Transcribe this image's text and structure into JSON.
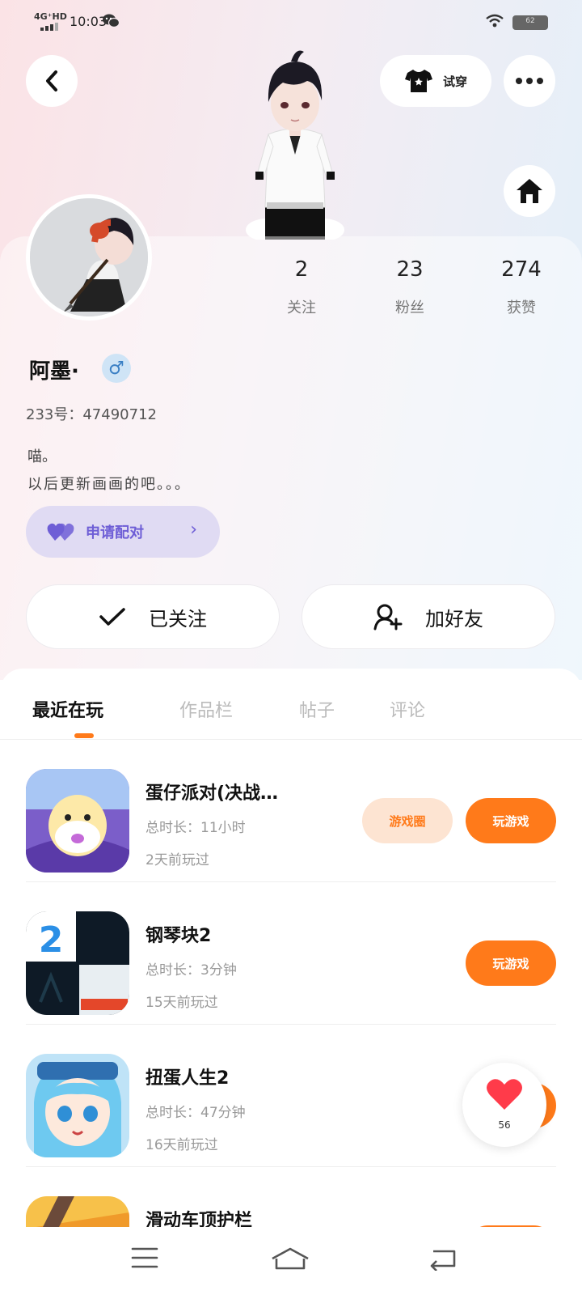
{
  "status_bar": {
    "network": "4G⁺HD",
    "time": "10:03",
    "battery": "62"
  },
  "header": {
    "try_on_label": "试穿"
  },
  "profile": {
    "stats": [
      {
        "count": "2",
        "label": "关注"
      },
      {
        "count": "23",
        "label": "粉丝"
      },
      {
        "count": "274",
        "label": "获赞"
      }
    ],
    "username": "阿墨·",
    "gender_symbol": "♂",
    "account_id": "233号：47490712",
    "bio_line1": "喵。",
    "bio_line2": "以后更新画画的吧。。。",
    "match_label": "申请配对",
    "followed_label": "已关注",
    "add_friend_label": "加好友"
  },
  "tabs": [
    {
      "label": "最近在玩",
      "active": true
    },
    {
      "label": "作品栏",
      "active": false
    },
    {
      "label": "帖子",
      "active": false
    },
    {
      "label": "评论",
      "active": false
    }
  ],
  "games": [
    {
      "name": "蛋仔派对(决战…",
      "total_time": "总时长：11小时",
      "last_played": "2天前玩过",
      "circle_label": "游戏圈",
      "play_label": "玩游戏"
    },
    {
      "name": "钢琴块2",
      "total_time": "总时长：3分钟",
      "last_played": "15天前玩过",
      "play_label": "玩游戏"
    },
    {
      "name": "扭蛋人生2",
      "total_time": "总时长：47分钟",
      "last_played": "16天前玩过"
    },
    {
      "name": "滑动车顶护栏"
    }
  ],
  "like_fab": {
    "count": "56"
  },
  "colors": {
    "accent_orange": "#ff7a1a",
    "match_purple": "#6e5ed6"
  }
}
